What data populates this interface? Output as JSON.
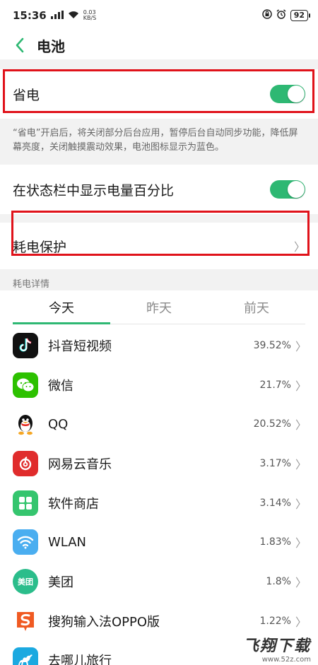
{
  "status_bar": {
    "time": "15:36",
    "net_speed_top": "0.03",
    "net_speed_bottom": "KB/S",
    "battery": "92"
  },
  "header": {
    "title": "电池"
  },
  "power_saving": {
    "label": "省电",
    "enabled": true,
    "description": "“省电”开启后，将关闭部分后台应用，暂停后台自动同步功能，降低屏幕亮度，关闭触摸震动效果，电池图标显示为蓝色。"
  },
  "show_percentage": {
    "label": "在状态栏中显示电量百分比",
    "enabled": true
  },
  "drain_protection": {
    "label": "耗电保护",
    "chevron": "〉"
  },
  "details": {
    "section_label": "耗电详情",
    "tabs": [
      {
        "label": "今天",
        "active": true
      },
      {
        "label": "昨天",
        "active": false
      },
      {
        "label": "前天",
        "active": false
      }
    ],
    "apps": [
      {
        "name": "抖音短视频",
        "pct": "39.52%",
        "icon": "tiktok-icon"
      },
      {
        "name": "微信",
        "pct": "21.7%",
        "icon": "wechat-icon"
      },
      {
        "name": "QQ",
        "pct": "20.52%",
        "icon": "qq-icon"
      },
      {
        "name": "网易云音乐",
        "pct": "3.17%",
        "icon": "netease-music-icon"
      },
      {
        "name": "软件商店",
        "pct": "3.14%",
        "icon": "app-store-icon"
      },
      {
        "name": "WLAN",
        "pct": "1.83%",
        "icon": "wlan-icon"
      },
      {
        "name": "美团",
        "pct": "1.8%",
        "icon": "meituan-icon"
      },
      {
        "name": "搜狗输入法OPPO版",
        "pct": "1.22%",
        "icon": "sogou-input-icon"
      },
      {
        "name": "去哪儿旅行",
        "pct": "",
        "icon": "qunar-icon"
      }
    ],
    "meituan_icon_text": "美团",
    "chevron": "〉"
  },
  "watermark": {
    "main": "飞翔下载",
    "url": "www.52z.com"
  },
  "colors": {
    "accent": "#2eb873",
    "highlight": "#e0121a"
  }
}
